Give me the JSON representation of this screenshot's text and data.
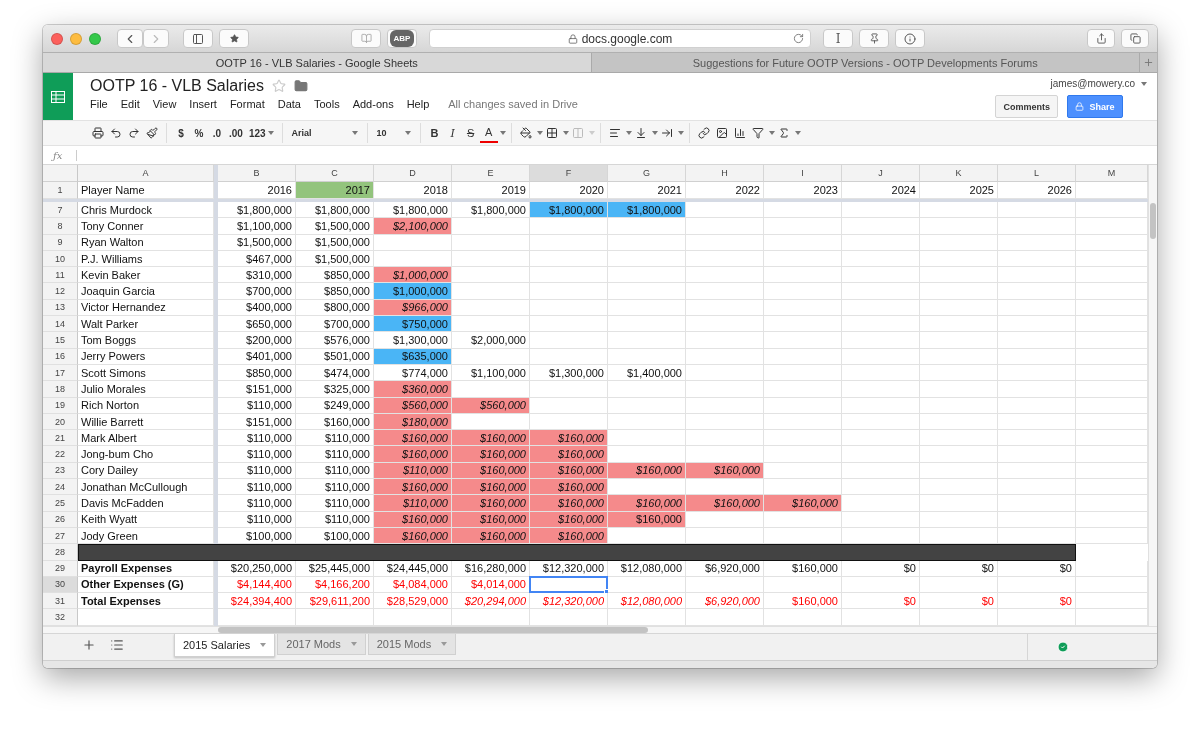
{
  "browser": {
    "address": "docs.google.com",
    "adblock": "ABP",
    "reader_button": "I",
    "tabs": [
      {
        "title": "OOTP 16 - VLB Salaries - Google Sheets",
        "selected": true
      },
      {
        "title": "Suggestions for Future OOTP Versions - OOTP Developments Forums",
        "selected": false
      }
    ]
  },
  "document": {
    "title": "OOTP 16 - VLB Salaries",
    "user": "james@mowery.co",
    "save_status": "All changes saved in Drive",
    "comments_button": "Comments",
    "share_button": "Share"
  },
  "formula_bar": {
    "label": "ƒx"
  },
  "menu": [
    "File",
    "Edit",
    "View",
    "Insert",
    "Format",
    "Data",
    "Tools",
    "Add-ons",
    "Help"
  ],
  "toolbar": {
    "currency": "$",
    "percent": "%",
    "decimal_less": ".0",
    "decimal_more": ".00",
    "number_format": "123",
    "font": "Arial",
    "font_size": "10",
    "bold": "B",
    "italic": "I",
    "strikethrough": "S",
    "text_color": "A"
  },
  "columns": [
    {
      "letter": "A",
      "selected": false
    },
    {
      "letter": "B",
      "selected": false
    },
    {
      "letter": "C",
      "selected": false
    },
    {
      "letter": "D",
      "selected": false
    },
    {
      "letter": "E",
      "selected": false
    },
    {
      "letter": "F",
      "selected": true
    },
    {
      "letter": "G",
      "selected": false
    },
    {
      "letter": "H",
      "selected": false
    },
    {
      "letter": "I",
      "selected": false
    },
    {
      "letter": "J",
      "selected": false
    },
    {
      "letter": "K",
      "selected": false
    },
    {
      "letter": "L",
      "selected": false
    },
    {
      "letter": "M",
      "selected": false
    }
  ],
  "rows": [
    {
      "number": "1",
      "kind": "header",
      "selected": false,
      "label": "Player Name",
      "cells": [
        {
          "text": "2016"
        },
        {
          "text": "2017",
          "color": "#93c47d"
        },
        {
          "text": "2018"
        },
        {
          "text": "2019"
        },
        {
          "text": "2020"
        },
        {
          "text": "2021"
        },
        {
          "text": "2022"
        },
        {
          "text": "2023"
        },
        {
          "text": "2024"
        },
        {
          "text": "2025"
        },
        {
          "text": "2026"
        }
      ]
    },
    {
      "number": "7",
      "kind": "player",
      "selected": false,
      "label": "Chris Murdock",
      "cells": [
        {
          "text": "$1,800,000"
        },
        {
          "text": "$1,800,000"
        },
        {
          "text": "$1,800,000"
        },
        {
          "text": "$1,800,000"
        },
        {
          "text": "$1,800,000",
          "color": "#4ab5f6"
        },
        {
          "text": "$1,800,000",
          "color": "#4ab5f6"
        }
      ]
    },
    {
      "number": "8",
      "kind": "player",
      "selected": false,
      "label": "Tony Conner",
      "cells": [
        {
          "text": "$1,100,000"
        },
        {
          "text": "$1,500,000"
        },
        {
          "text": "$2,100,000",
          "color": "#f58a8b",
          "italic": true
        }
      ]
    },
    {
      "number": "9",
      "kind": "player",
      "selected": false,
      "label": "Ryan Walton",
      "cells": [
        {
          "text": "$1,500,000"
        },
        {
          "text": "$1,500,000"
        }
      ]
    },
    {
      "number": "10",
      "kind": "player",
      "selected": false,
      "label": "P.J. Williams",
      "cells": [
        {
          "text": "$467,000"
        },
        {
          "text": "$1,500,000"
        }
      ]
    },
    {
      "number": "11",
      "kind": "player",
      "selected": false,
      "label": "Kevin Baker",
      "cells": [
        {
          "text": "$310,000"
        },
        {
          "text": "$850,000"
        },
        {
          "text": "$1,000,000",
          "color": "#f58a8b",
          "italic": true
        }
      ]
    },
    {
      "number": "12",
      "kind": "player",
      "selected": false,
      "label": "Joaquin Garcia",
      "cells": [
        {
          "text": "$700,000"
        },
        {
          "text": "$850,000"
        },
        {
          "text": "$1,000,000",
          "color": "#4ab5f6"
        }
      ]
    },
    {
      "number": "13",
      "kind": "player",
      "selected": false,
      "label": "Victor Hernandez",
      "cells": [
        {
          "text": "$400,000"
        },
        {
          "text": "$800,000"
        },
        {
          "text": "$966,000",
          "color": "#f58a8b",
          "italic": true
        }
      ]
    },
    {
      "number": "14",
      "kind": "player",
      "selected": false,
      "label": "Walt Parker",
      "cells": [
        {
          "text": "$650,000"
        },
        {
          "text": "$700,000"
        },
        {
          "text": "$750,000",
          "color": "#4ab5f6"
        }
      ]
    },
    {
      "number": "15",
      "kind": "player",
      "selected": false,
      "label": "Tom Boggs",
      "cells": [
        {
          "text": "$200,000"
        },
        {
          "text": "$576,000"
        },
        {
          "text": "$1,300,000"
        },
        {
          "text": "$2,000,000"
        }
      ]
    },
    {
      "number": "16",
      "kind": "player",
      "selected": false,
      "label": "Jerry Powers",
      "cells": [
        {
          "text": "$401,000"
        },
        {
          "text": "$501,000"
        },
        {
          "text": "$635,000",
          "color": "#4ab5f6"
        }
      ]
    },
    {
      "number": "17",
      "kind": "player",
      "selected": false,
      "label": "Scott Simons",
      "cells": [
        {
          "text": "$850,000"
        },
        {
          "text": "$474,000"
        },
        {
          "text": "$774,000"
        },
        {
          "text": "$1,100,000"
        },
        {
          "text": "$1,300,000"
        },
        {
          "text": "$1,400,000"
        }
      ]
    },
    {
      "number": "18",
      "kind": "player",
      "selected": false,
      "label": "Julio Morales",
      "cells": [
        {
          "text": "$151,000"
        },
        {
          "text": "$325,000"
        },
        {
          "text": "$360,000",
          "color": "#f58a8b",
          "italic": true
        }
      ]
    },
    {
      "number": "19",
      "kind": "player",
      "selected": false,
      "label": "Rich Norton",
      "cells": [
        {
          "text": "$110,000"
        },
        {
          "text": "$249,000"
        },
        {
          "text": "$560,000",
          "color": "#f58a8b",
          "italic": true
        },
        {
          "text": "$560,000",
          "color": "#f58a8b",
          "italic": true
        }
      ]
    },
    {
      "number": "20",
      "kind": "player",
      "selected": false,
      "label": "Willie Barrett",
      "cells": [
        {
          "text": "$151,000"
        },
        {
          "text": "$160,000"
        },
        {
          "text": "$180,000",
          "color": "#f58a8b",
          "italic": true
        }
      ]
    },
    {
      "number": "21",
      "kind": "player",
      "selected": false,
      "label": "Mark Albert",
      "cells": [
        {
          "text": "$110,000"
        },
        {
          "text": "$110,000"
        },
        {
          "text": "$160,000",
          "color": "#f58a8b",
          "italic": true
        },
        {
          "text": "$160,000",
          "color": "#f58a8b",
          "italic": true
        },
        {
          "text": "$160,000",
          "color": "#f58a8b",
          "italic": true
        }
      ]
    },
    {
      "number": "22",
      "kind": "player",
      "selected": false,
      "label": "Jong-bum Cho",
      "cells": [
        {
          "text": "$110,000"
        },
        {
          "text": "$110,000"
        },
        {
          "text": "$160,000",
          "color": "#f58a8b",
          "italic": true
        },
        {
          "text": "$160,000",
          "color": "#f58a8b",
          "italic": true
        },
        {
          "text": "$160,000",
          "color": "#f58a8b",
          "italic": true
        }
      ]
    },
    {
      "number": "23",
      "kind": "player",
      "selected": false,
      "label": "Cory Dailey",
      "cells": [
        {
          "text": "$110,000"
        },
        {
          "text": "$110,000"
        },
        {
          "text": "$110,000",
          "color": "#f58a8b",
          "italic": true
        },
        {
          "text": "$160,000",
          "color": "#f58a8b",
          "italic": true
        },
        {
          "text": "$160,000",
          "color": "#f58a8b",
          "italic": true
        },
        {
          "text": "$160,000",
          "color": "#f58a8b",
          "italic": true
        },
        {
          "text": "$160,000",
          "color": "#f58a8b",
          "italic": true
        }
      ]
    },
    {
      "number": "24",
      "kind": "player",
      "selected": false,
      "label": "Jonathan McCullough",
      "cells": [
        {
          "text": "$110,000"
        },
        {
          "text": "$110,000"
        },
        {
          "text": "$160,000",
          "color": "#f58a8b",
          "italic": true
        },
        {
          "text": "$160,000",
          "color": "#f58a8b",
          "italic": true
        },
        {
          "text": "$160,000",
          "color": "#f58a8b",
          "italic": true
        }
      ]
    },
    {
      "number": "25",
      "kind": "player",
      "selected": false,
      "label": "Davis McFadden",
      "cells": [
        {
          "text": "$110,000"
        },
        {
          "text": "$110,000"
        },
        {
          "text": "$110,000",
          "color": "#f58a8b",
          "italic": true
        },
        {
          "text": "$160,000",
          "color": "#f58a8b",
          "italic": true
        },
        {
          "text": "$160,000",
          "color": "#f58a8b",
          "italic": true
        },
        {
          "text": "$160,000",
          "color": "#f58a8b",
          "italic": true
        },
        {
          "text": "$160,000",
          "color": "#f58a8b",
          "italic": true
        },
        {
          "text": "$160,000",
          "color": "#f58a8b",
          "italic": true
        }
      ]
    },
    {
      "number": "26",
      "kind": "player",
      "selected": false,
      "label": "Keith Wyatt",
      "cells": [
        {
          "text": "$110,000"
        },
        {
          "text": "$110,000"
        },
        {
          "text": "$160,000",
          "color": "#f58a8b",
          "italic": true
        },
        {
          "text": "$160,000",
          "color": "#f58a8b",
          "italic": true
        },
        {
          "text": "$160,000",
          "color": "#f58a8b",
          "italic": true
        },
        {
          "text": "$160,000",
          "color": "#f58a8b"
        }
      ]
    },
    {
      "number": "27",
      "kind": "player",
      "selected": false,
      "label": "Jody Green",
      "cells": [
        {
          "text": "$100,000"
        },
        {
          "text": "$100,000"
        },
        {
          "text": "$160,000",
          "color": "#f58a8b",
          "italic": true
        },
        {
          "text": "$160,000",
          "color": "#f58a8b",
          "italic": true
        },
        {
          "text": "$160,000",
          "color": "#f58a8b",
          "italic": true
        }
      ]
    },
    {
      "number": "28",
      "kind": "divider",
      "selected": false
    },
    {
      "number": "29",
      "kind": "summary",
      "selected": false,
      "red_text": false,
      "label": "Payroll Expenses",
      "cells": [
        {
          "text": "$20,250,000"
        },
        {
          "text": "$25,445,000"
        },
        {
          "text": "$24,445,000"
        },
        {
          "text": "$16,280,000"
        },
        {
          "text": "$12,320,000"
        },
        {
          "text": "$12,080,000"
        },
        {
          "text": "$6,920,000"
        },
        {
          "text": "$160,000"
        },
        {
          "text": "$0"
        },
        {
          "text": "$0"
        },
        {
          "text": "$0"
        }
      ]
    },
    {
      "number": "30",
      "kind": "summary",
      "selected": true,
      "red_text": true,
      "label": "Other Expenses (G)",
      "cells": [
        {
          "text": "$4,144,400"
        },
        {
          "text": "$4,166,200"
        },
        {
          "text": "$4,084,000"
        },
        {
          "text": "$4,014,000"
        }
      ]
    },
    {
      "number": "31",
      "kind": "summary",
      "selected": false,
      "red_text": true,
      "label": "Total Expenses",
      "cells": [
        {
          "text": "$24,394,400"
        },
        {
          "text": "$29,611,200"
        },
        {
          "text": "$28,529,000"
        },
        {
          "text": "$20,294,000",
          "italic": true
        },
        {
          "text": "$12,320,000",
          "italic": true
        },
        {
          "text": "$12,080,000",
          "italic": true
        },
        {
          "text": "$6,920,000",
          "italic": true
        },
        {
          "text": "$160,000"
        },
        {
          "text": "$0"
        },
        {
          "text": "$0"
        },
        {
          "text": "$0"
        }
      ]
    },
    {
      "number": "32",
      "kind": "empty",
      "selected": false
    }
  ],
  "sheets": [
    {
      "name": "2015 Salaries",
      "selected": true
    },
    {
      "name": "2017 Mods",
      "selected": false
    },
    {
      "name": "2015 Mods",
      "selected": false
    }
  ]
}
